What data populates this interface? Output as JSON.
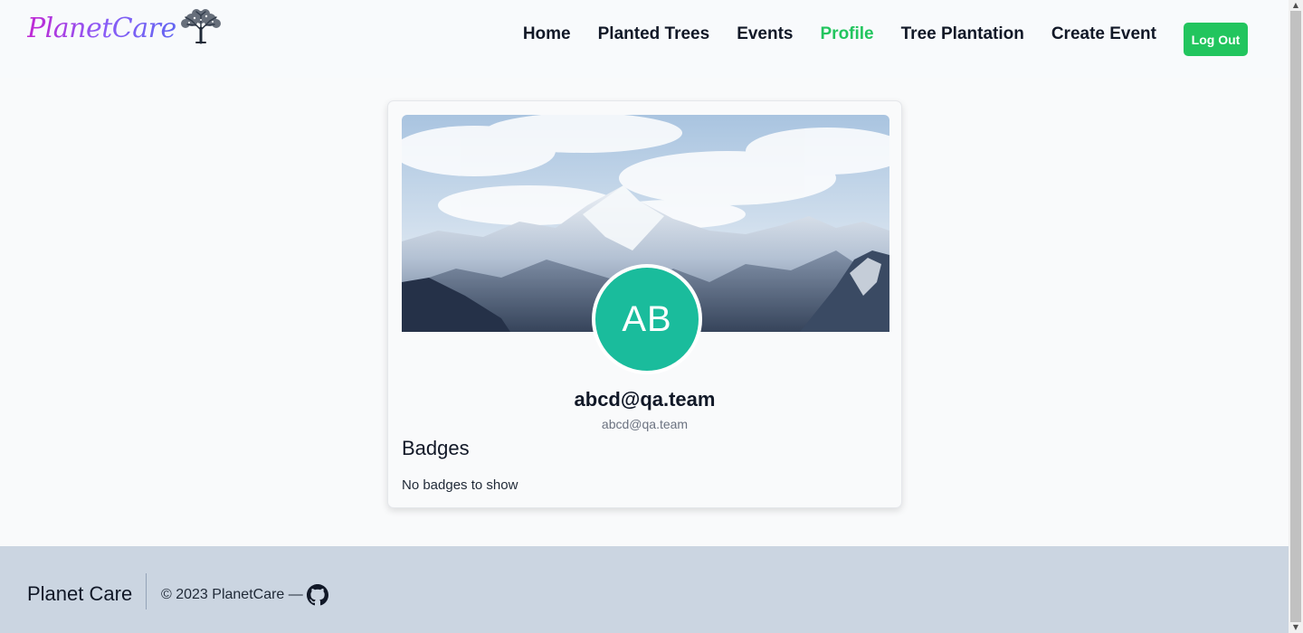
{
  "brand": {
    "logo_text": "PlanetCare",
    "icon": "tree-icon"
  },
  "nav": {
    "items": [
      {
        "label": "Home",
        "active": false
      },
      {
        "label": "Planted Trees",
        "active": false
      },
      {
        "label": "Events",
        "active": false
      },
      {
        "label": "Profile",
        "active": true
      },
      {
        "label": "Tree Plantation",
        "active": false
      },
      {
        "label": "Create Event",
        "active": false
      }
    ],
    "logout_label": "Log Out"
  },
  "profile": {
    "avatar_initials": "AB",
    "name": "abcd@qa.team",
    "email": "abcd@qa.team",
    "banner": "mountain-landscape-image",
    "badges_title": "Badges",
    "badges_empty": "No badges to show"
  },
  "footer": {
    "brand": "Planet Care",
    "copyright": "© 2023 PlanetCare —",
    "icon": "github-icon"
  },
  "colors": {
    "accent": "#22c55e",
    "avatar_bg": "#1abc9c",
    "footer_bg": "#cbd5e1",
    "page_bg": "#f9fafb"
  }
}
